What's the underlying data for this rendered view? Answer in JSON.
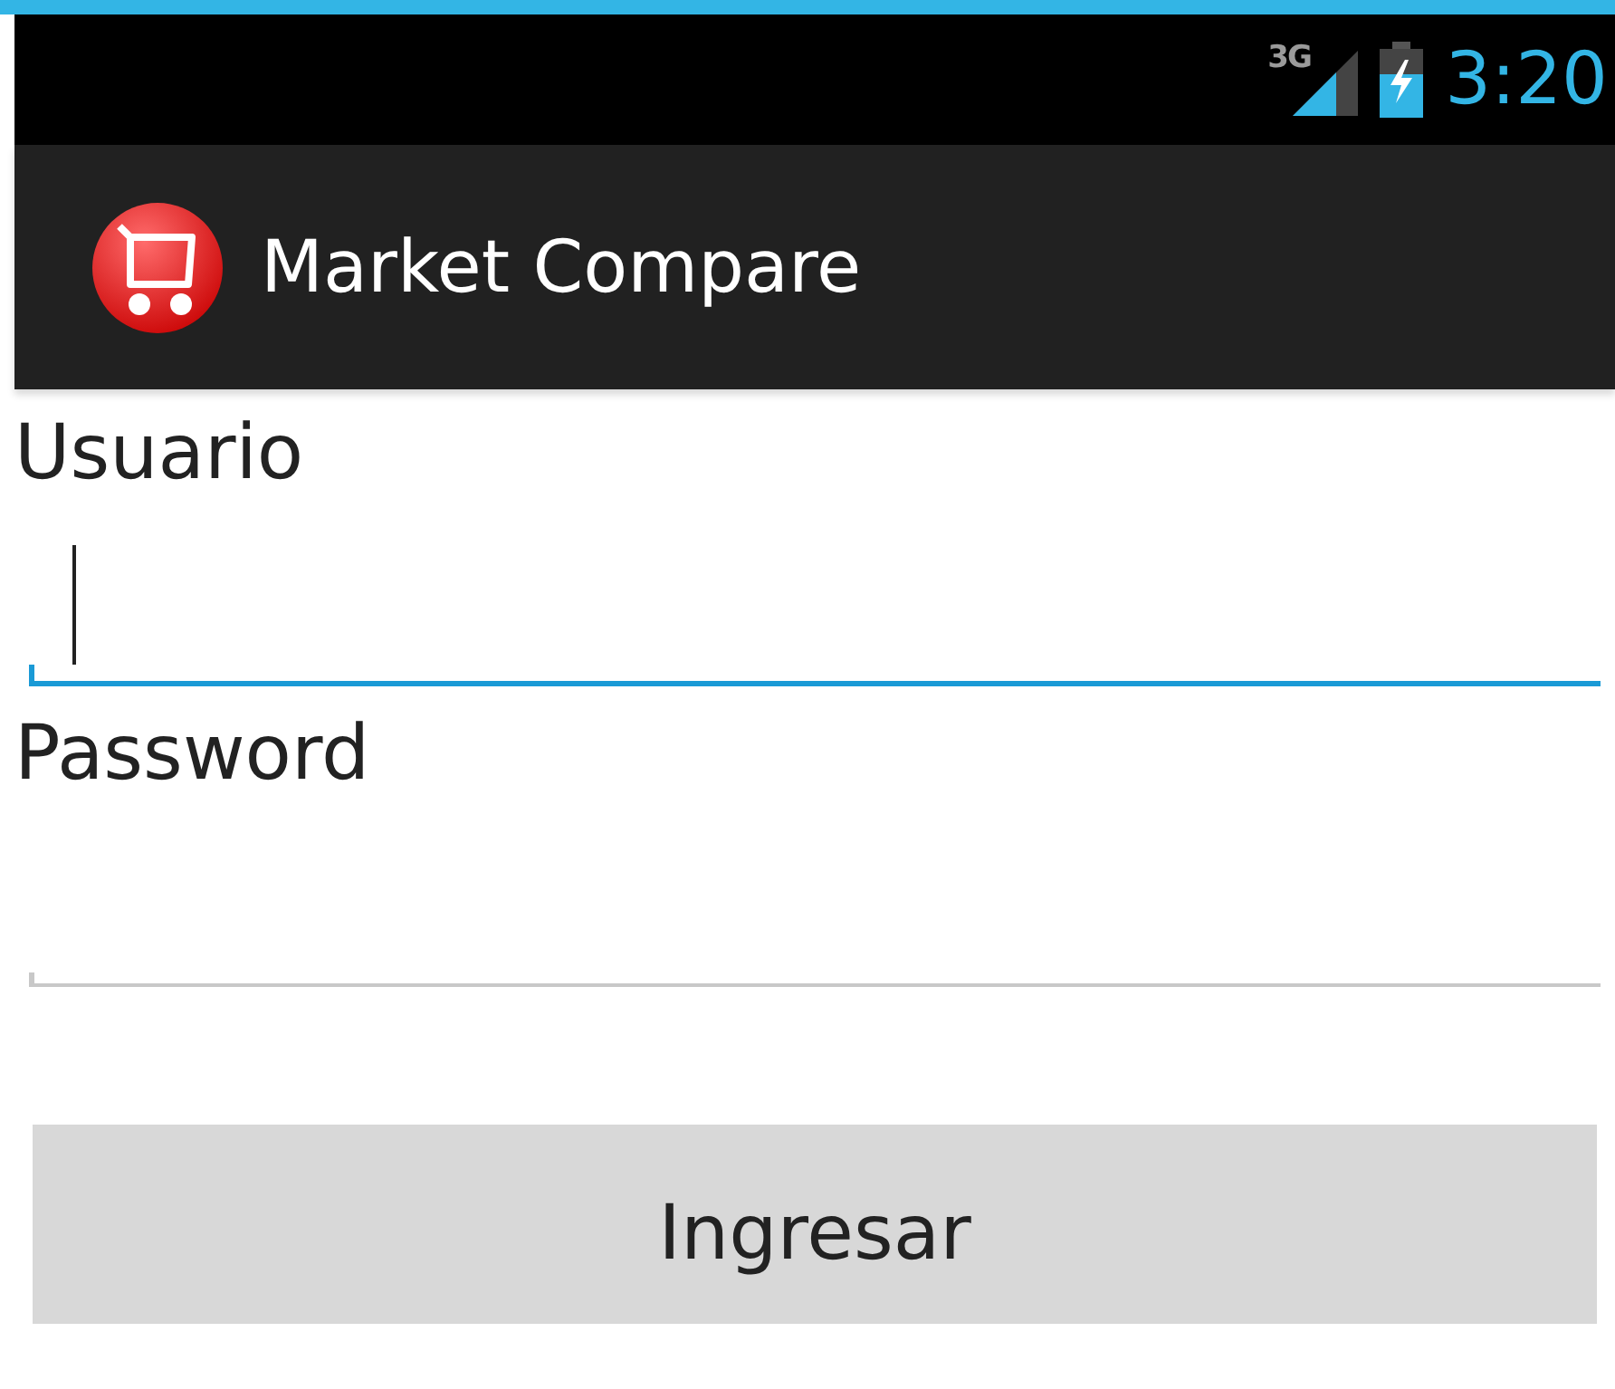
{
  "status_bar": {
    "network": "3G",
    "time": "3:20"
  },
  "action_bar": {
    "title": "Market Compare"
  },
  "fields": [
    {
      "label": "Usuario",
      "focused": true
    },
    {
      "label": "Password",
      "focused": false
    }
  ],
  "button": {
    "label": "Ingresar"
  }
}
